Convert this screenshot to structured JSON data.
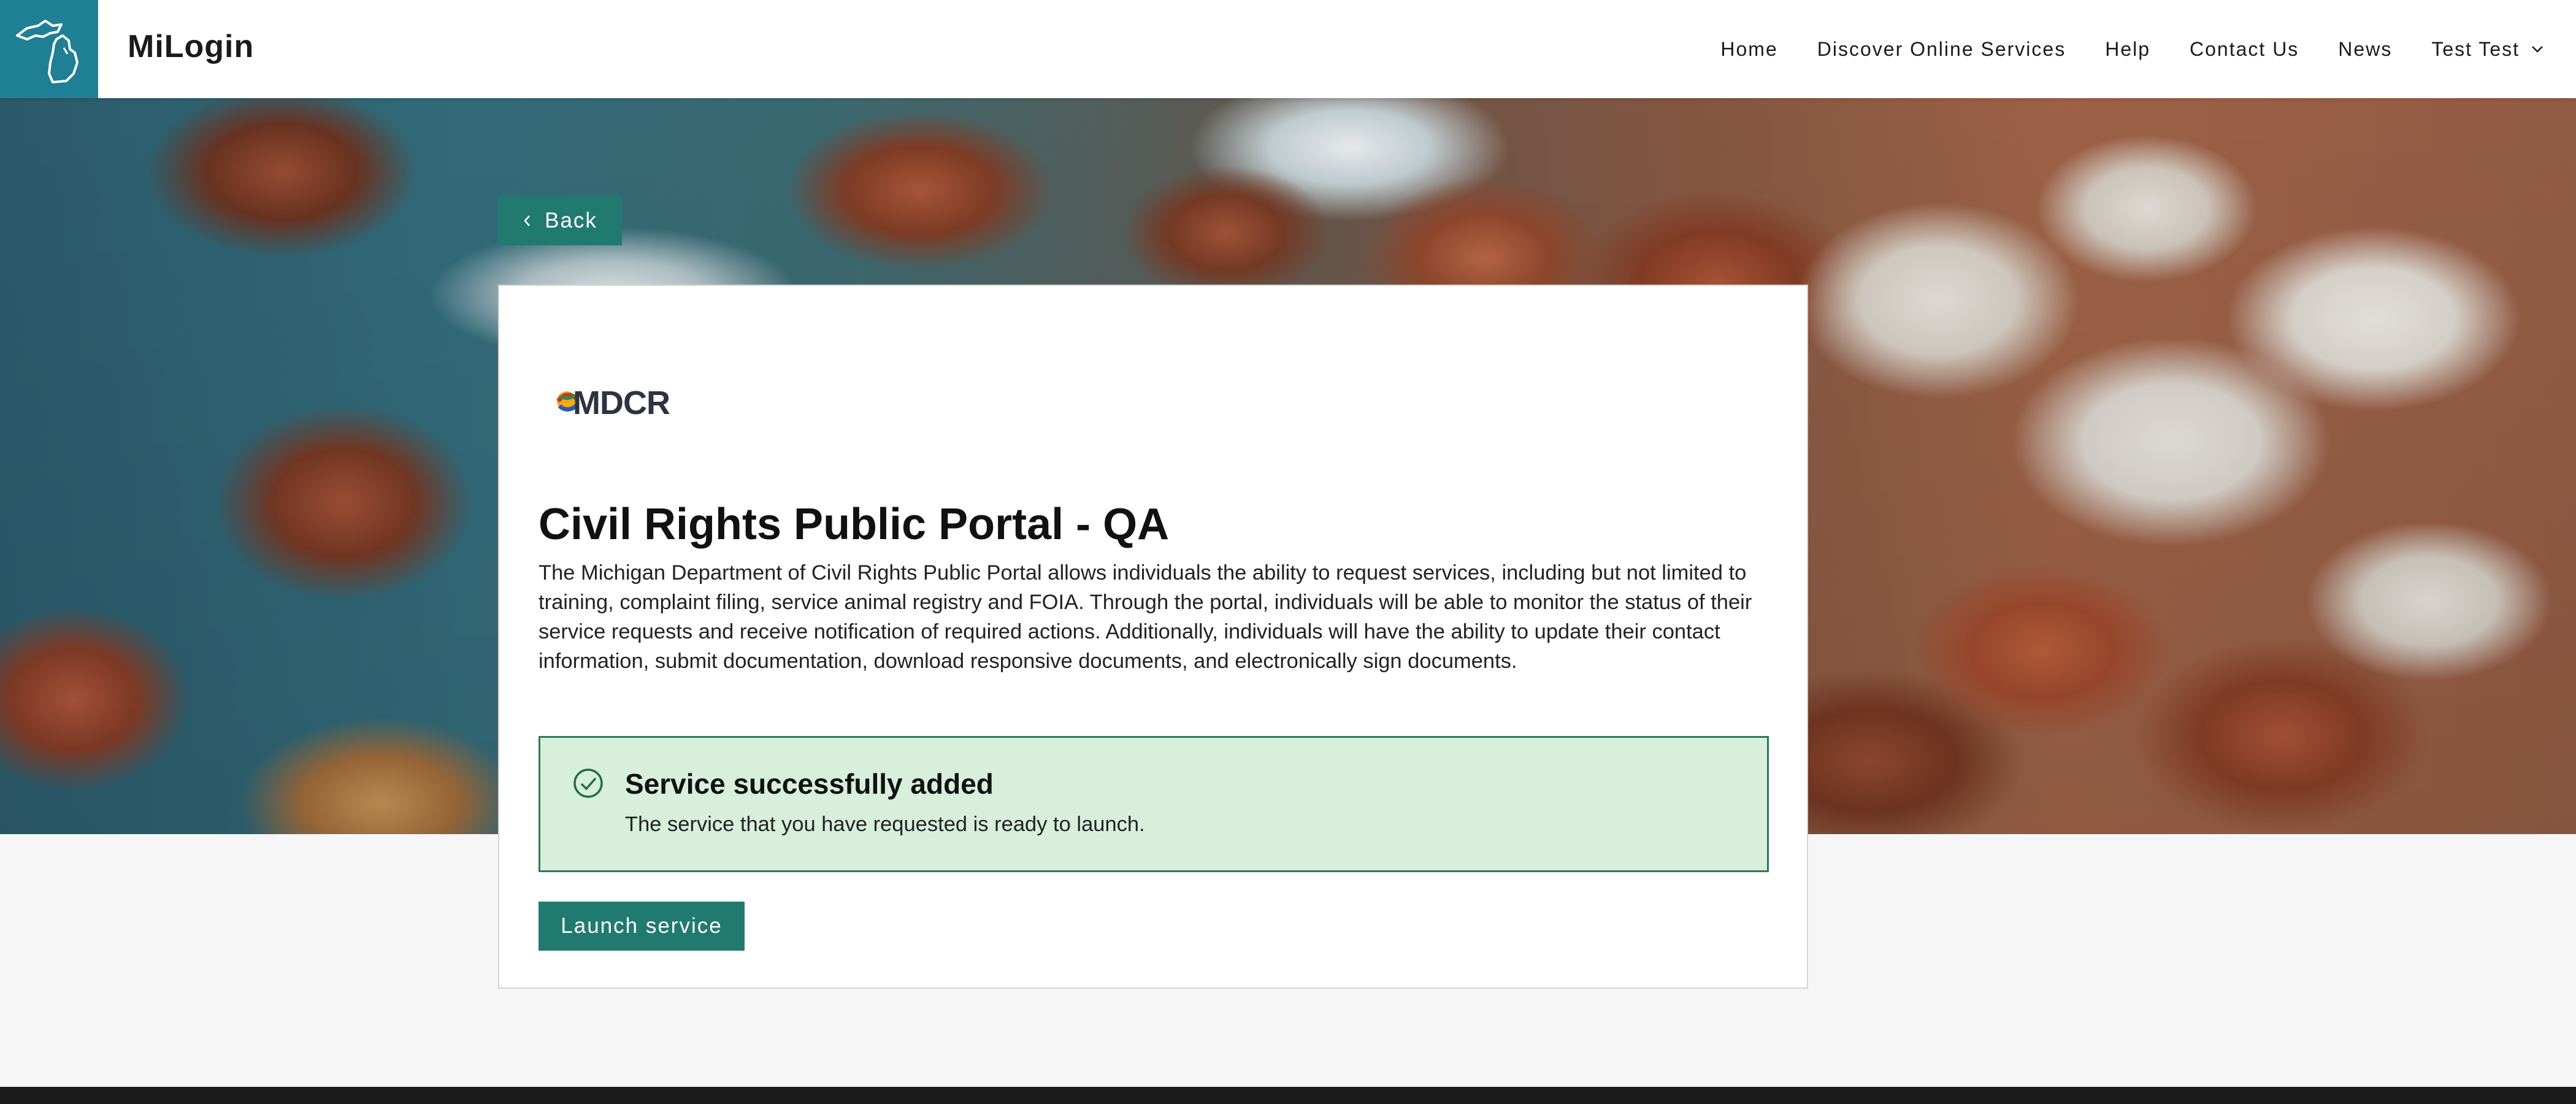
{
  "header": {
    "brand": "MiLogin",
    "nav": [
      {
        "label": "Home"
      },
      {
        "label": "Discover Online Services"
      },
      {
        "label": "Help"
      },
      {
        "label": "Contact Us"
      },
      {
        "label": "News"
      }
    ],
    "user_menu": {
      "label": "Test Test"
    }
  },
  "back_button": {
    "label": "Back"
  },
  "card": {
    "agency_logo_text": "MDCR",
    "title": "Civil Rights Public Portal - QA",
    "description": "The Michigan Department of Civil Rights Public Portal allows individuals the ability to request services, including but not limited to training, complaint filing, service animal registry and FOIA. Through the portal, individuals will be able to monitor the status of their service requests and receive notification of required actions. Additionally, individuals will have the ability to update their contact information, submit documentation, download responsive documents, and electronically sign documents.",
    "alert": {
      "title": "Service successfully added",
      "text": "The service that you have requested is ready to launch."
    },
    "launch_button": {
      "label": "Launch service"
    }
  },
  "colors": {
    "header_tile": "#1f7f95",
    "button": "#217a70",
    "alert_bg": "#d7efdb",
    "alert_border": "#2d7a5b"
  }
}
